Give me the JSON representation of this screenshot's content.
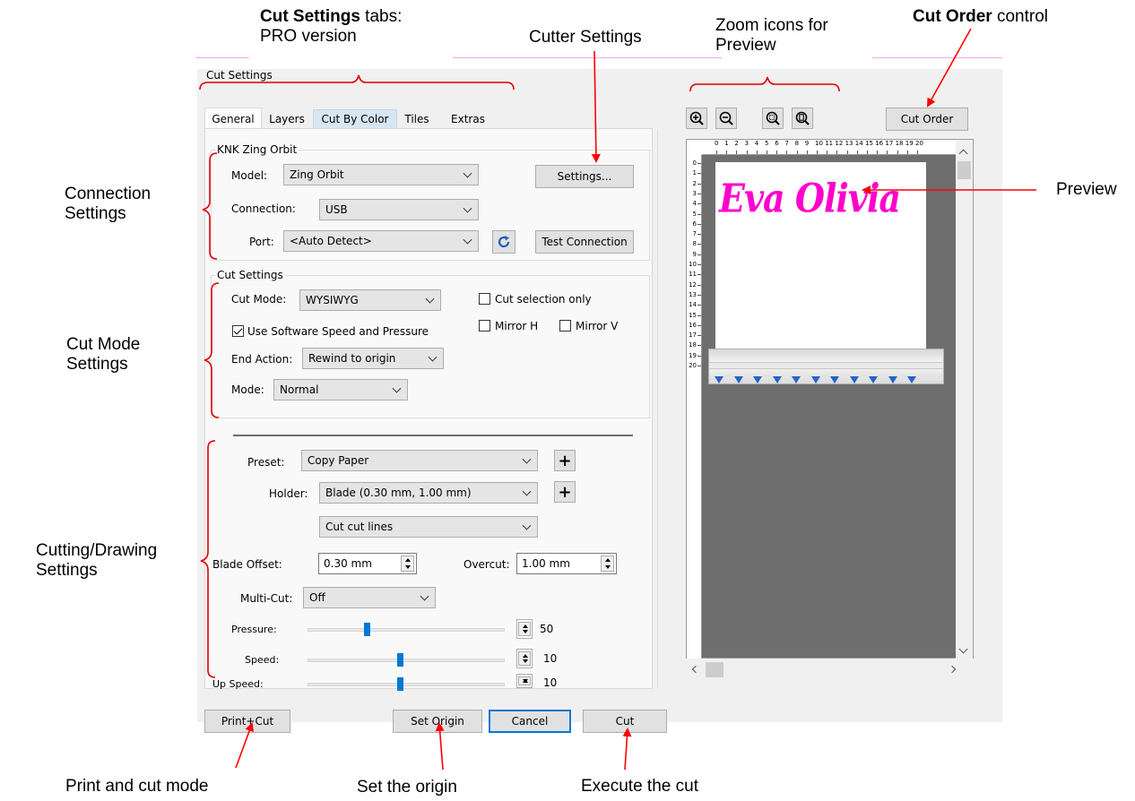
{
  "annotations": {
    "cut_settings_tabs_bold": "Cut Settings",
    "cut_settings_tabs_rest": " tabs:",
    "cut_settings_tabs_line2": "PRO version",
    "cutter_settings": "Cutter Settings",
    "zoom_icons_line1": "Zoom icons for",
    "zoom_icons_line2": "Preview",
    "cut_order_bold": "Cut Order",
    "cut_order_rest": " control",
    "connection_line1": "Connection",
    "connection_line2": "Settings",
    "cutmode_line1": "Cut Mode",
    "cutmode_line2": "Settings",
    "cutting_line1": "Cutting/Drawing",
    "cutting_line2": "Settings",
    "preview": "Preview",
    "print_and_cut": "Print and cut mode",
    "set_origin": "Set the origin",
    "execute_cut": "Execute the cut"
  },
  "dialog": {
    "title": "Cut Settings",
    "tabs": [
      "General",
      "Layers",
      "Cut By Color",
      "Tiles",
      "Extras"
    ],
    "active_tab": "General",
    "machine_group": {
      "title": "KNK Zing Orbit",
      "model_label": "Model:",
      "model_value": "Zing Orbit",
      "settings_button": "Settings...",
      "connection_label": "Connection:",
      "connection_value": "USB",
      "port_label": "Port:",
      "port_value": "<Auto Detect>",
      "test_button": "Test Connection"
    },
    "cut_group": {
      "title": "Cut Settings",
      "cut_mode_label": "Cut Mode:",
      "cut_mode_value": "WYSIWYG",
      "cut_selection_label": "Cut selection only",
      "cut_selection_checked": false,
      "mirror_h_label": "Mirror H",
      "mirror_h_checked": false,
      "mirror_v_label": "Mirror V",
      "mirror_v_checked": false,
      "software_speed_label": "Use Software Speed and Pressure",
      "software_speed_checked": true,
      "end_action_label": "End Action:",
      "end_action_value": "Rewind to origin",
      "mode_label": "Mode:",
      "mode_value": "Normal"
    },
    "cutting": {
      "preset_label": "Preset:",
      "preset_value": "Copy Paper",
      "holder_label": "Holder:",
      "holder_value": "Blade (0.30 mm, 1.00 mm)",
      "lines_value": "Cut cut lines",
      "blade_offset_label": "Blade Offset:",
      "blade_offset_value": "0.30 mm",
      "overcut_label": "Overcut:",
      "overcut_value": "1.00 mm",
      "multicut_label": "Multi-Cut:",
      "multicut_value": "Off",
      "pressure_label": "Pressure:",
      "pressure_value": "50",
      "pressure_fraction": 0.3,
      "speed_label": "Speed:",
      "speed_value": "10",
      "speed_fraction": 0.47,
      "upspeed_label": "Up Speed:",
      "upspeed_value": "10",
      "upspeed_fraction": 0.47
    },
    "preview": {
      "cut_order_button": "Cut Order",
      "ruler_top_numbers": [
        "0",
        "1",
        "2",
        "3",
        "4",
        "5",
        "6",
        "7",
        "8",
        "9",
        "10",
        "11",
        "12",
        "13",
        "14",
        "15",
        "16",
        "17",
        "18",
        "19",
        "20"
      ],
      "ruler_left_numbers": [
        "0",
        "1",
        "2",
        "3",
        "4",
        "5",
        "6",
        "7",
        "8",
        "9",
        "10",
        "11",
        "12",
        "13",
        "14",
        "15",
        "16",
        "17",
        "18",
        "19",
        "20"
      ],
      "preview_text": "Eva Olivia",
      "preview_text_color": "#ff00cc"
    },
    "bottom_buttons": {
      "print_cut": "Print+Cut",
      "set_origin": "Set Origin",
      "cancel": "Cancel",
      "cut": "Cut"
    }
  }
}
